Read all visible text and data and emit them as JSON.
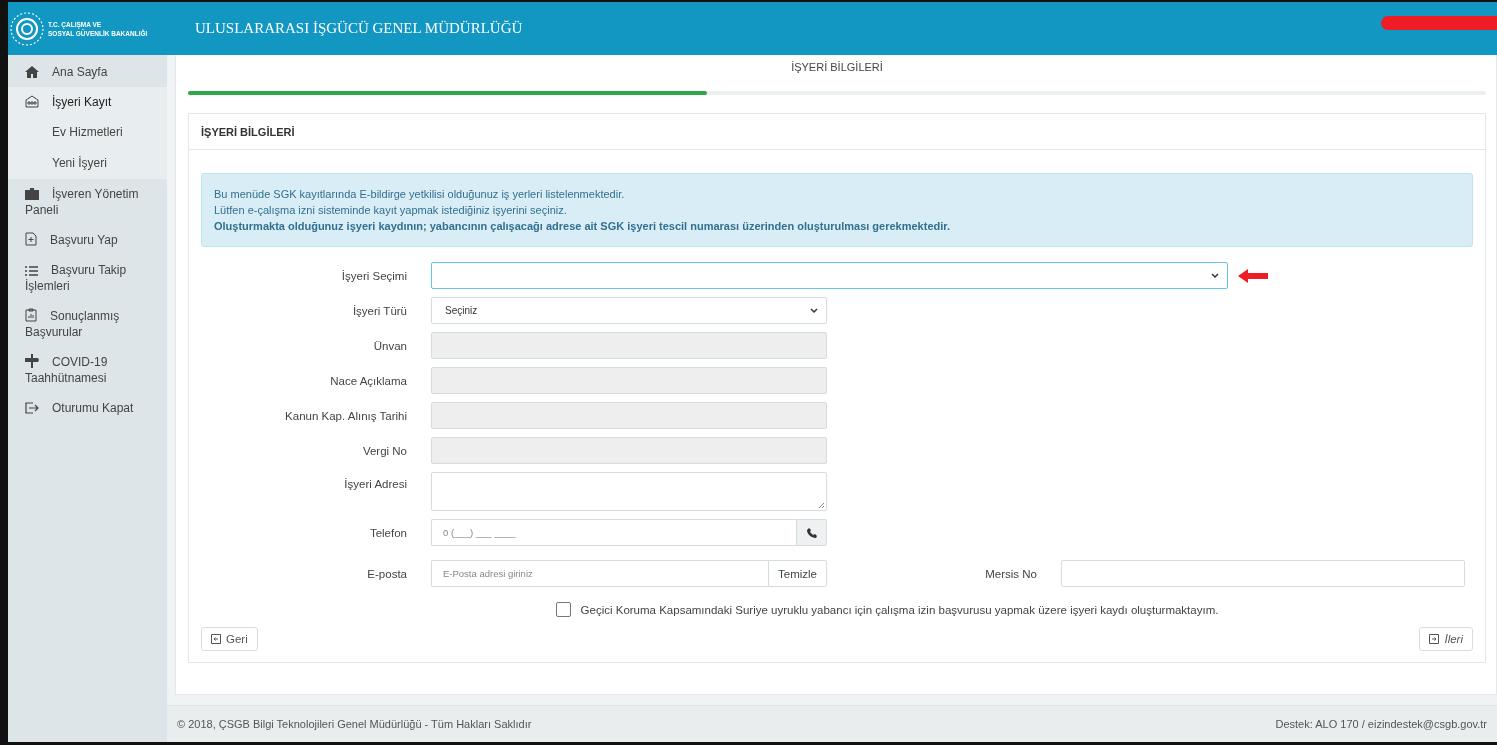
{
  "header": {
    "logo_lines": [
      "T.C. ÇALIŞMA VE",
      "SOSYAL GÜVENLİK BAKANLIĞI"
    ],
    "title": "ULUSLARARASI İŞGÜCÜ GENEL MÜDÜRLÜĞÜ"
  },
  "sidebar": {
    "items": [
      {
        "label": "Ana Sayfa",
        "selected": false
      },
      {
        "label": "İşyeri Kayıt",
        "selected": true,
        "children": [
          {
            "label": "Ev Hizmetleri"
          },
          {
            "label": "Yeni İşyeri"
          }
        ]
      },
      {
        "label": "İşveren Yönetim Paneli",
        "selected": false
      },
      {
        "label": "Başvuru Yap",
        "selected": false
      },
      {
        "label": "Başvuru Takip İşlemleri",
        "selected": false
      },
      {
        "label": "Sonuçlanmış Başvurular",
        "selected": false
      },
      {
        "label": "COVID-19 Taahhütnamesi",
        "selected": false
      },
      {
        "label": "Oturumu Kapat",
        "selected": false
      }
    ]
  },
  "step": {
    "title": "İŞYERİ BİLGİLERİ",
    "level": 0.4
  },
  "card": {
    "title": "İŞYERİ BİLGİLERİ",
    "info_lines": [
      "Bu menüde SGK kayıtlarında E-bildirge yetkilisi olduğunuz iş yerleri listelenmektedir.",
      "Lütfen e-çalışma izni sisteminde kayıt yapmak istediğiniz işyerini seçiniz.",
      "**Oluşturmakta olduğunuz işyeri kaydının; yabancının çalışacağı adrese ait SGK işyeri tescil numarası üzerinden oluşturulması gerekmektedir.**"
    ],
    "fields": [
      {
        "kind": "wide_select",
        "label": "İşyeri Seçimi",
        "focused": true,
        "pointer": true
      },
      {
        "kind": "select",
        "label": "İşyeri Türü",
        "value": "Seçiniz",
        "focused": false
      },
      {
        "kind": "readonly",
        "label": "Ünvan"
      },
      {
        "kind": "readonly",
        "label": "Nace Açıklama"
      },
      {
        "kind": "readonly",
        "label": "Kanun Kap. Alınış Tarihi"
      },
      {
        "kind": "readonly",
        "label": "Vergi No"
      },
      {
        "kind": "textarea",
        "label": "İşyeri Adresi"
      },
      {
        "kind": "phone",
        "label": "Telefon",
        "placeholder": "0 (___) ___ ____"
      },
      {
        "kind": "email",
        "label": "E-posta",
        "placeholder": "E-Posta adresi giriniz",
        "button": "Temizle",
        "side_label": "Mersis No"
      }
    ],
    "checkbox": {
      "label": "Geçici Koruma Kapsamındaki Suriye uyruklu yabancı için çalışma izin başvurusu yapmak üzere işyeri kaydı oluşturmaktayım.",
      "checked": false
    },
    "back_button": "Geri",
    "next_button": "İleri"
  },
  "footer": {
    "left": "© 2018, ÇSGB Bilgi Teknolojileri Genel Müdürlüğü - Tüm Hakları Saklıdır",
    "right": "Destek: ALO 170 / eizindestek@csgb.gov.tr"
  }
}
